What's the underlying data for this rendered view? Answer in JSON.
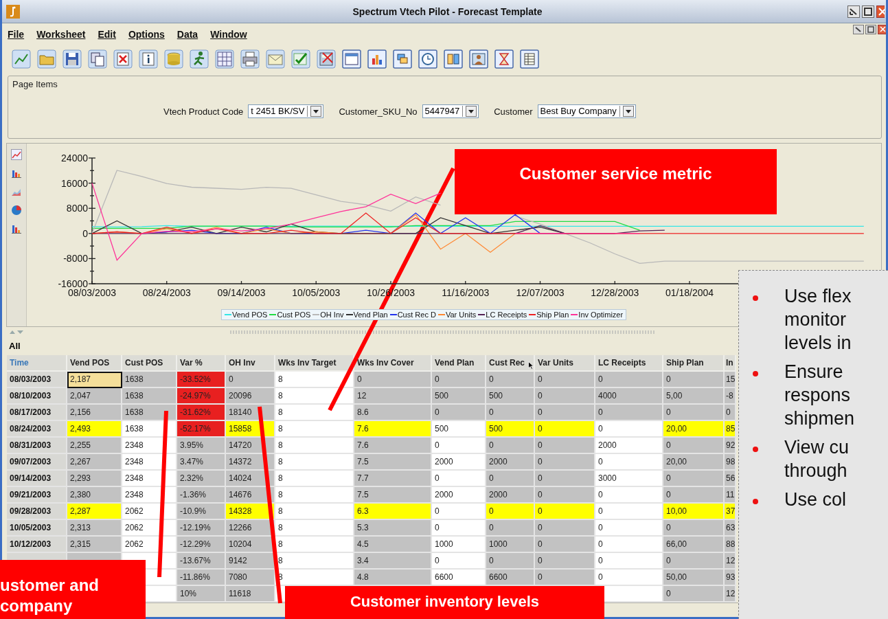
{
  "window": {
    "title": "Spectrum Vtech Pilot - Forecast Template"
  },
  "menu": [
    {
      "label": "File"
    },
    {
      "label": "Worksheet"
    },
    {
      "label": "Edit"
    },
    {
      "label": "Options"
    },
    {
      "label": "Data"
    },
    {
      "label": "Window"
    }
  ],
  "page_items": {
    "title": "Page Items",
    "fields": [
      {
        "label": "Vtech Product Code",
        "value": "t 2451 BK/SV"
      },
      {
        "label": "Customer_SKU_No",
        "value": "5447947"
      },
      {
        "label": "Customer",
        "value": "Best Buy Company"
      }
    ]
  },
  "chart": {
    "chart_data": {
      "type": "line",
      "categories": [
        "08/03/2003",
        null,
        null,
        "08/24/2003",
        null,
        null,
        "09/14/2003",
        null,
        null,
        "10/05/2003",
        null,
        null,
        "10/26/2003",
        null,
        null,
        "11/16/2003",
        null,
        null,
        "12/07/2003",
        null,
        null,
        "12/28/2003",
        null,
        null,
        "01/18/2004",
        null,
        null,
        null,
        null,
        null,
        null,
        null
      ],
      "ylim": [
        -16000,
        24000
      ],
      "yticks": [
        24000,
        16000,
        8000,
        0,
        -8000,
        -16000
      ],
      "series": [
        {
          "name": "Vend POS",
          "color": "#33e6e6",
          "values": [
            2187,
            2047,
            2156,
            2493,
            2255,
            2267,
            2293,
            2380,
            2287,
            2313,
            2315,
            2311,
            2300,
            2300,
            2300,
            2300,
            2300,
            2300,
            2300,
            2300,
            2300,
            2300,
            2300,
            2300,
            2300,
            2300,
            2300,
            2300,
            2300,
            2300,
            2300,
            2300
          ]
        },
        {
          "name": "Cust POS",
          "color": "#22dd44",
          "values": [
            1638,
            1638,
            1638,
            1638,
            2348,
            2348,
            2348,
            2348,
            2062,
            2062,
            2062,
            2062,
            2062,
            2500,
            2500,
            2500,
            2500,
            3800,
            3800,
            3800,
            3800,
            3800,
            1000,
            null,
            null,
            null,
            null,
            null,
            null,
            null,
            null,
            null
          ]
        },
        {
          "name": "OH Inv",
          "color": "#b8b8b8",
          "values": [
            0,
            20096,
            18140,
            15858,
            14720,
            14372,
            14024,
            14676,
            14328,
            12266,
            10204,
            9142,
            7080,
            11618,
            9000,
            null,
            null,
            5500,
            3000,
            0,
            -3000,
            -6500,
            -9500,
            -8800,
            -8800,
            -8800,
            -8800,
            -8800,
            -8800,
            -8800,
            -8800,
            -8800
          ]
        },
        {
          "name": "Vend Plan",
          "color": "#333333",
          "values": [
            0,
            4000,
            0,
            500,
            2000,
            0,
            2000,
            500,
            3000,
            500,
            0,
            0,
            0,
            0,
            5000,
            2500,
            0,
            1000,
            2000,
            0,
            0,
            0,
            null,
            null,
            null,
            null,
            null,
            null,
            null,
            null,
            null,
            null
          ]
        },
        {
          "name": "Cust Rec D",
          "color": "#2233ee",
          "values": [
            null,
            null,
            0,
            500,
            1000,
            0,
            0,
            2000,
            0,
            0,
            0,
            1000,
            0,
            6500,
            0,
            5000,
            0,
            6000,
            0,
            0,
            null,
            null,
            null,
            null,
            null,
            null,
            null,
            null,
            null,
            null,
            null,
            null
          ]
        },
        {
          "name": "Var Units",
          "color": "#ff8833",
          "values": [
            0,
            500,
            0,
            1500,
            0,
            2000,
            0,
            1500,
            0,
            500,
            0,
            0,
            0,
            6000,
            -5000,
            0,
            -6000,
            0,
            0,
            null,
            null,
            null,
            null,
            null,
            null,
            null,
            null,
            null,
            null,
            null,
            null,
            null
          ]
        },
        {
          "name": "LC Receipts",
          "color": "#552255",
          "values": [
            0,
            0,
            0,
            0,
            0,
            0,
            0,
            0,
            0,
            0,
            0,
            0,
            0,
            0,
            0,
            0,
            0,
            0,
            2500,
            0,
            0,
            0,
            800,
            1000,
            null,
            null,
            null,
            null,
            null,
            null,
            null,
            null
          ]
        },
        {
          "name": "Ship Plan",
          "color": "#ee2222",
          "values": [
            0,
            500,
            0,
            2000,
            0,
            1500,
            0,
            0,
            1000,
            0,
            0,
            6500,
            0,
            5000,
            0,
            0,
            0,
            0,
            0,
            0,
            0,
            0,
            0,
            0,
            0,
            0,
            0,
            0,
            0,
            0,
            0,
            0
          ]
        },
        {
          "name": "Inv Optimizer",
          "color": "#ff3399",
          "values": [
            16000,
            -8500,
            0,
            700,
            500,
            1500,
            800,
            1500,
            3000,
            5000,
            7000,
            8500,
            12500,
            9500,
            12800,
            null,
            null,
            0,
            0,
            0,
            0,
            0,
            0,
            null,
            null,
            null,
            null,
            null,
            null,
            null,
            null,
            null
          ]
        }
      ]
    }
  },
  "table": {
    "scope": "All",
    "columns": [
      {
        "label": "Time",
        "kind": "time"
      },
      {
        "label": "Vend POS",
        "kind": "calc"
      },
      {
        "label": "Cust POS",
        "kind": "input"
      },
      {
        "label": "Var %",
        "kind": "variance"
      },
      {
        "label": "OH Inv",
        "kind": "calc"
      },
      {
        "label": "Wks Inv Target",
        "kind": "target"
      },
      {
        "label": "Wks Inv Cover",
        "kind": "calc"
      },
      {
        "label": "Vend Plan",
        "kind": "input"
      },
      {
        "label": "Cust Rec",
        "kind": "calc"
      },
      {
        "label": "Var Units",
        "kind": "calc"
      },
      {
        "label": "LC Receipts",
        "kind": "input"
      },
      {
        "label": "Ship Plan",
        "kind": "calc"
      },
      {
        "label": "In",
        "kind": "calc"
      }
    ],
    "rows": [
      {
        "cells": [
          "08/03/2003",
          "2,187",
          "1638",
          "-33.52%",
          "0",
          "8",
          "0",
          "0",
          "0",
          "0",
          "0",
          "0",
          "15"
        ],
        "locked": true,
        "highlight": false,
        "alert": true,
        "selected": true
      },
      {
        "cells": [
          "08/10/2003",
          "2,047",
          "1638",
          "-24.97%",
          "20096",
          "8",
          "12",
          "500",
          "500",
          "0",
          "4000",
          "5,00",
          "-8"
        ],
        "locked": true,
        "highlight": false,
        "alert": true,
        "selected": false
      },
      {
        "cells": [
          "08/17/2003",
          "2,156",
          "1638",
          "-31.62%",
          "18140",
          "8",
          "8.6",
          "0",
          "0",
          "0",
          "0",
          "0",
          "0"
        ],
        "locked": true,
        "highlight": false,
        "alert": true,
        "selected": false
      },
      {
        "cells": [
          "08/24/2003",
          "2,493",
          "1638",
          "-52.17%",
          "15858",
          "8",
          "7.6",
          "500",
          "500",
          "0",
          "0",
          "20,00",
          "85"
        ],
        "locked": false,
        "highlight": true,
        "alert": true,
        "selected": false
      },
      {
        "cells": [
          "08/31/2003",
          "2,255",
          "2348",
          "3.95%",
          "14720",
          "8",
          "7.6",
          "0",
          "0",
          "0",
          "2000",
          "0",
          "92"
        ],
        "locked": false,
        "highlight": false,
        "alert": false,
        "selected": false
      },
      {
        "cells": [
          "09/07/2003",
          "2,267",
          "2348",
          "3.47%",
          "14372",
          "8",
          "7.5",
          "2000",
          "2000",
          "0",
          "0",
          "20,00",
          "98"
        ],
        "locked": false,
        "highlight": false,
        "alert": false,
        "selected": false
      },
      {
        "cells": [
          "09/14/2003",
          "2,293",
          "2348",
          "2.32%",
          "14024",
          "8",
          "7.7",
          "0",
          "0",
          "0",
          "3000",
          "0",
          "56"
        ],
        "locked": false,
        "highlight": false,
        "alert": false,
        "selected": false
      },
      {
        "cells": [
          "09/21/2003",
          "2,380",
          "2348",
          "-1.36%",
          "14676",
          "8",
          "7.5",
          "2000",
          "2000",
          "0",
          "0",
          "0",
          "11"
        ],
        "locked": false,
        "highlight": false,
        "alert": false,
        "selected": false
      },
      {
        "cells": [
          "09/28/2003",
          "2,287",
          "2062",
          "-10.9%",
          "14328",
          "8",
          "6.3",
          "0",
          "0",
          "0",
          "0",
          "10,00",
          "37"
        ],
        "locked": false,
        "highlight": true,
        "alert": false,
        "selected": false
      },
      {
        "cells": [
          "10/05/2003",
          "2,313",
          "2062",
          "-12.19%",
          "12266",
          "8",
          "5.3",
          "0",
          "0",
          "0",
          "0",
          "0",
          "63"
        ],
        "locked": false,
        "highlight": false,
        "alert": false,
        "selected": false
      },
      {
        "cells": [
          "10/12/2003",
          "2,315",
          "2062",
          "-12.29%",
          "10204",
          "8",
          "4.5",
          "1000",
          "1000",
          "0",
          "0",
          "66,00",
          "88"
        ],
        "locked": false,
        "highlight": false,
        "alert": false,
        "selected": false
      },
      {
        "cells": [
          null,
          null,
          null,
          "-13.67%",
          "9142",
          "8",
          "3.4",
          "0",
          "0",
          "0",
          "0",
          "0",
          "12"
        ],
        "locked": false,
        "highlight": false,
        "alert": false
      },
      {
        "cells": [
          null,
          null,
          null,
          "-11.86%",
          "7080",
          "8",
          "4.8",
          "6600",
          "6600",
          "0",
          "0",
          "50,00",
          "93"
        ],
        "locked": false,
        "highlight": false,
        "alert": false
      },
      {
        "cells": [
          null,
          null,
          null,
          "10%",
          "11618",
          null,
          null,
          null,
          null,
          null,
          null,
          "0",
          "12"
        ],
        "highlight": false,
        "alert": false
      }
    ]
  },
  "callouts": [
    {
      "lines": [
        "Customer service metric"
      ]
    },
    {
      "lines": [
        "ustomer and",
        "company"
      ]
    },
    {
      "lines": [
        "Customer inventory levels"
      ]
    }
  ],
  "notes": {
    "bullets": [
      {
        "lines": [
          "Use flex",
          "monitor",
          "levels in"
        ]
      },
      {
        "lines": [
          "Ensure",
          "respons",
          "shipmen"
        ]
      },
      {
        "lines": [
          "View cu",
          "through"
        ]
      },
      {
        "lines": [
          "Use col"
        ]
      }
    ]
  }
}
